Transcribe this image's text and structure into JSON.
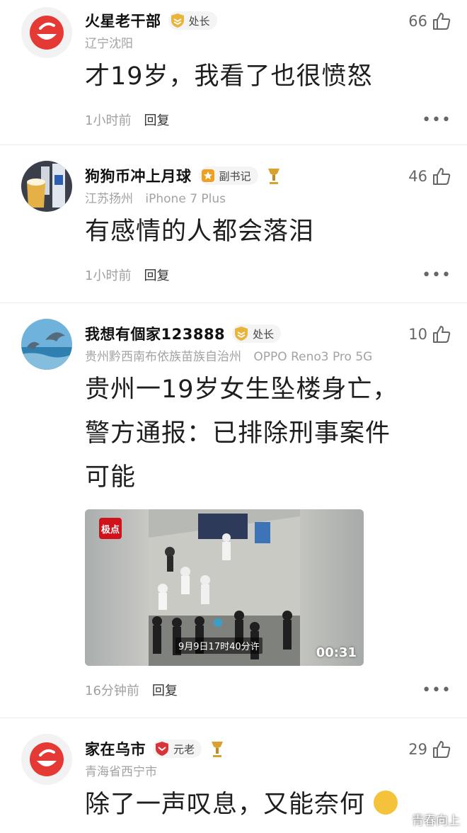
{
  "comments": [
    {
      "username": "火星老干部",
      "badge": "处长",
      "badge_color": "#e8b43a",
      "likes": "66",
      "meta": [
        "辽宁沈阳"
      ],
      "text": "才19岁，我看了也很愤怒",
      "time": "1小时前",
      "reply": "回复",
      "avatar": "red-bowl-icon"
    },
    {
      "username": "狗狗币冲上月球",
      "badge": "副书记",
      "badge_color": "#f0a020",
      "medal": "trophy-medal-icon",
      "likes": "46",
      "meta": [
        "江苏扬州",
        "iPhone 7 Plus"
      ],
      "text": "有感情的人都会落泪",
      "time": "1小时前",
      "reply": "回复",
      "avatar": "beer-photo"
    },
    {
      "username": "我想有個家123888",
      "badge": "处长",
      "badge_color": "#e8b43a",
      "likes": "10",
      "meta": [
        "贵州黔西南布依族苗族自治州",
        "OPPO Reno3 Pro 5G"
      ],
      "text_lines": [
        "贵州一19岁女生坠楼身亡，",
        "警方通报：已排除刑事案件",
        "可能"
      ],
      "video": {
        "logo": "极点",
        "caption": "9月9日17时40分许",
        "duration": "00:31"
      },
      "time": "16分钟前",
      "reply": "回复",
      "avatar": "dolphin-photo"
    },
    {
      "username": "家在乌市",
      "badge": "元老",
      "badge_color": "#d8323a",
      "medal": "trophy-medal-icon",
      "likes": "29",
      "meta": [
        "青海省西宁市"
      ],
      "text": "除了一声叹息，又能奈何",
      "avatar": "red-bowl-icon"
    }
  ],
  "more_label": "•••",
  "watermark": "青春向上"
}
